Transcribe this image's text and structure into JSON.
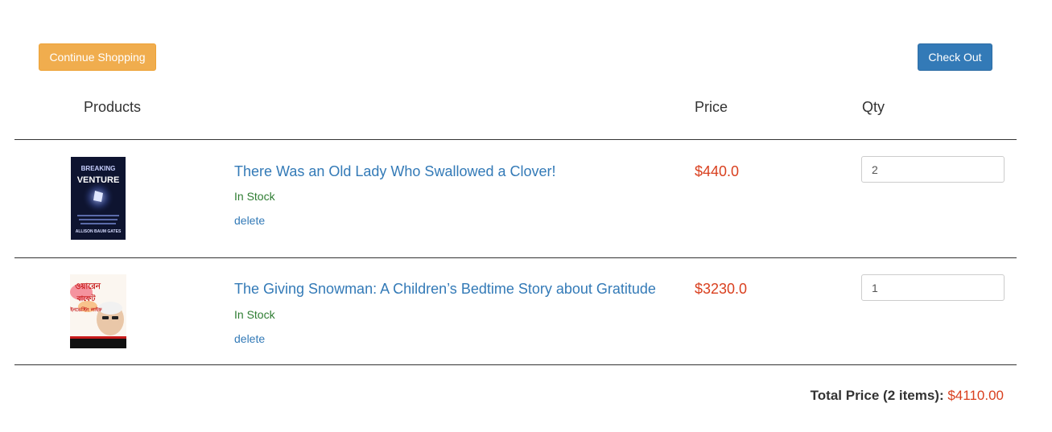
{
  "actions": {
    "continue_label": "Continue Shopping",
    "checkout_label": "Check Out"
  },
  "columns": {
    "products": "Products",
    "price": "Price",
    "qty": "Qty"
  },
  "items": [
    {
      "title": "There Was an Old Lady Who Swallowed a Clover!",
      "stock": "In Stock",
      "delete_label": "delete",
      "price": "$440.0",
      "qty": "2",
      "cover": {
        "line1": "BREAKING",
        "line2": "VENTURE",
        "author": "ALLISON BAUM GATES"
      }
    },
    {
      "title": "The Giving Snowman: A Children’s Bedtime Story about Gratitude",
      "stock": "In Stock",
      "delete_label": "delete",
      "price": "$3230.0",
      "qty": "1",
      "cover": {
        "line1": "ওয়ারেন",
        "line2": "বাফেট",
        "line3": "ইনভেস্টিং লাইফ"
      }
    }
  ],
  "summary": {
    "label": "Total Price (2 items):",
    "value": "$4110.00"
  },
  "colors": {
    "warning": "#f0ad4e",
    "primary": "#337ab7",
    "price": "#d9401f",
    "stock": "#2e7d32"
  }
}
